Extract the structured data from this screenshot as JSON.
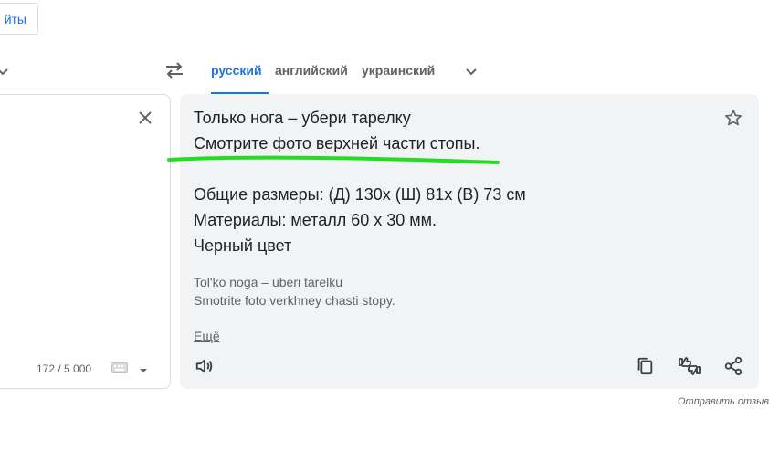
{
  "top": {
    "sites_label": "йты"
  },
  "languages": {
    "target": [
      {
        "label": "русский",
        "active": true
      },
      {
        "label": "английский",
        "active": false
      },
      {
        "label": "украинский",
        "active": false
      }
    ]
  },
  "source": {
    "char_count": "172 / 5 000"
  },
  "translation": {
    "lines": [
      "Только нога – убери тарелку",
      "Смотрите фото верхней части стопы.",
      "",
      "Общие размеры: (Д) 130х (Ш) 81х (В) 73 см",
      "Материалы: металл 60 х 30 мм.",
      "Черный цвет"
    ],
    "transliteration": [
      "Tol'ko noga – uberi tarelku",
      "Smotrite foto verkhney chasti stopy."
    ],
    "more_label": "Ещё"
  },
  "footer": {
    "feedback_label": "Отправить отзыв"
  },
  "colors": {
    "accent": "#1a73e8",
    "highlight": "#22dd22",
    "panel_bg": "#f1f3f4"
  },
  "icons": [
    "chevron-down-icon",
    "swap-icon",
    "close-icon",
    "keyboard-icon",
    "star-icon",
    "speaker-icon",
    "copy-icon",
    "feedback-thumbs-icon",
    "share-icon"
  ]
}
